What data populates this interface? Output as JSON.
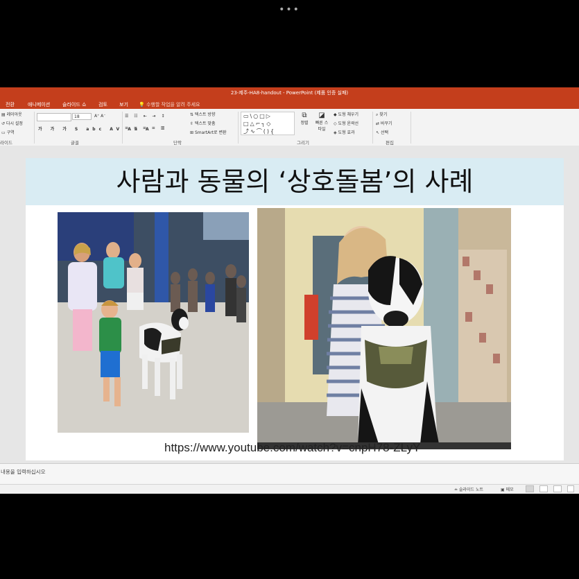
{
  "window": {
    "dots": "•••",
    "title": "23-제주-HA8-handout - PowerPoint (제품 인증 실패)"
  },
  "tabs": [
    "전환",
    "애니메이션",
    "슬라이드 쇼",
    "검토",
    "보기"
  ],
  "tellme": "수행할 작업을 알려 주세요",
  "ribbon": {
    "slides_group": {
      "layout": "레이아웃",
      "reset": "다시 설정",
      "section": "구역",
      "label": "라이드"
    },
    "font_group": {
      "size": "18",
      "label": "글꼴"
    },
    "paragraph_group": {
      "text_direction": "텍스트 방향",
      "align_text": "텍스트 맞춤",
      "smartart": "SmartArt로 변환",
      "label": "단락"
    },
    "drawing_group": {
      "arrange": "정렬",
      "quick_styles": "빠른 스타일",
      "fill": "도형 채우기",
      "outline": "도형 윤곽선",
      "effects": "도형 효과",
      "label": "그리기"
    },
    "editing_group": {
      "find": "찾기",
      "replace": "바꾸기",
      "select": "선택",
      "label": "편집"
    }
  },
  "slide": {
    "title": "사람과 동물의 ‘상호돌봄’의 사례",
    "url": "https://www.youtube.com/watch?v=cnpH78-ZLyY"
  },
  "notes_placeholder": "내용을 입력하십시오",
  "statusbar": {
    "notes": "슬라이드 노트",
    "comments": "메모"
  }
}
